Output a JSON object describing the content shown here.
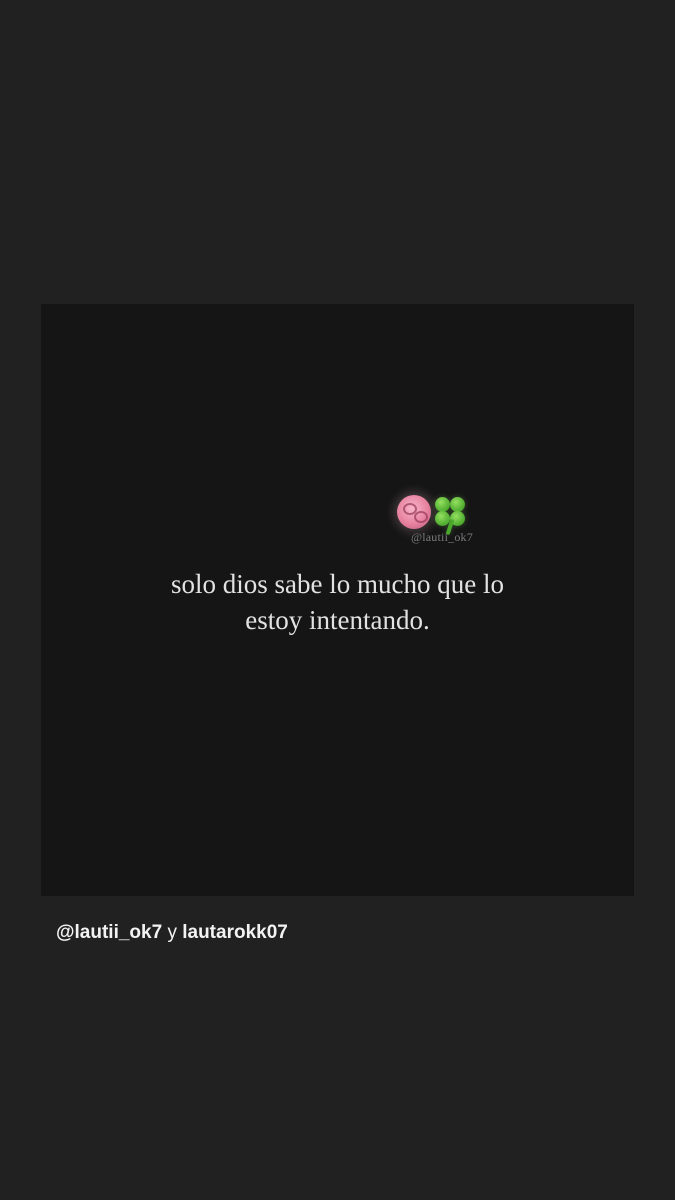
{
  "post": {
    "emoji": {
      "first": "brain-emoji",
      "second": "four-leaf-clover-emoji"
    },
    "watermark": "@lautii_ok7",
    "quote_lines": [
      "solo dios sabe lo mucho que lo",
      "estoy intentando."
    ]
  },
  "mentions": {
    "user_1": "@lautii_ok7",
    "conjunction": "y",
    "user_2": "lautarokk07"
  }
}
